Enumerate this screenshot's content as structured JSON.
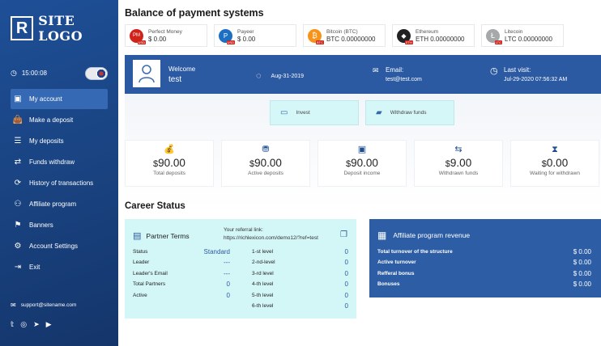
{
  "sidebar": {
    "logo_letter": "R",
    "logo_text": "SITE LOGO",
    "time": "15:00:08",
    "nav": [
      {
        "label": "My account",
        "icon": "user-icon"
      },
      {
        "label": "Make a deposit",
        "icon": "wallet-icon"
      },
      {
        "label": "My deposits",
        "icon": "list-icon"
      },
      {
        "label": "Funds withdraw",
        "icon": "withdraw-icon"
      },
      {
        "label": "History of transactions",
        "icon": "history-icon"
      },
      {
        "label": "Affiliate program",
        "icon": "affiliate-icon"
      },
      {
        "label": "Banners",
        "icon": "banner-icon"
      },
      {
        "label": "Account Settings",
        "icon": "settings-icon"
      },
      {
        "label": "Exit",
        "icon": "exit-icon"
      }
    ],
    "support_email": "support@sitename.com"
  },
  "main": {
    "title": "Balance of payment systems",
    "payments": [
      {
        "name": "Perfect Money",
        "value": "$ 0.00",
        "tag": "USD",
        "color": "#d0231a",
        "letter": "PM"
      },
      {
        "name": "Payeer",
        "value": "$ 0.00",
        "tag": "USD",
        "color": "#1d6fc4",
        "letter": "P"
      },
      {
        "name": "Bitcoin (BTC)",
        "value": "BTC 0.00000000",
        "tag": "BTC",
        "color": "#f7931a",
        "letter": "₿"
      },
      {
        "name": "Ethereum",
        "value": "ETH 0.00000000",
        "tag": "ETH",
        "color": "#222222",
        "letter": "◆"
      },
      {
        "name": "Litecoin",
        "value": "LTC 0.00000000",
        "tag": "LTC",
        "color": "#a6a9aa",
        "letter": "Ł"
      }
    ],
    "welcome": {
      "label": "Welcome",
      "user": "test",
      "date": "Aug-31-2019",
      "email_label": "Email:",
      "email": "test@test.com",
      "visit_label": "Last visit:",
      "visit": "Jul-29-2020 07:56:32 AM"
    },
    "actions": {
      "invest": "Invest",
      "withdraw": "Withdraw funds"
    },
    "stats": [
      {
        "value": "90.00",
        "label": "Total deposits",
        "icon": "money-bag-icon"
      },
      {
        "value": "90.00",
        "label": "Active deposits",
        "icon": "coins-icon"
      },
      {
        "value": "90.00",
        "label": "Deposit income",
        "icon": "safe-icon"
      },
      {
        "value": "9.00",
        "label": "Withdrawn funds",
        "icon": "transfer-icon"
      },
      {
        "value": "0.00",
        "label": "Waiting for withdrawn",
        "icon": "hourglass-icon"
      }
    ],
    "career_title": "Career Status",
    "partner": {
      "title": "Partner Terms",
      "ref_label": "Your referral link:",
      "ref_link": "https://richlexicon.com/demo12/?ref=test",
      "rows": [
        {
          "label": "Status",
          "value": "Standard"
        },
        {
          "label": "Leader",
          "value": "---"
        },
        {
          "label": "Leader's Email",
          "value": "---"
        },
        {
          "label": "Total Partners",
          "value": "0"
        },
        {
          "label": "Active",
          "value": "0"
        }
      ],
      "levels": [
        {
          "label": "1-st level",
          "value": "0"
        },
        {
          "label": "2-nd-level",
          "value": "0"
        },
        {
          "label": "3-rd level",
          "value": "0"
        },
        {
          "label": "4-th level",
          "value": "0"
        },
        {
          "label": "5-th level",
          "value": "0"
        },
        {
          "label": "6-th level",
          "value": "0"
        }
      ]
    },
    "affiliate": {
      "title": "Affiliate program revenue",
      "rows": [
        {
          "label": "Total turnover of the structure",
          "value": "$ 0.00"
        },
        {
          "label": "Active turnover",
          "value": "$ 0.00"
        },
        {
          "label": "Refferal bonus",
          "value": "$ 0.00"
        },
        {
          "label": "Bonuses",
          "value": "$ 0.00"
        }
      ]
    }
  }
}
